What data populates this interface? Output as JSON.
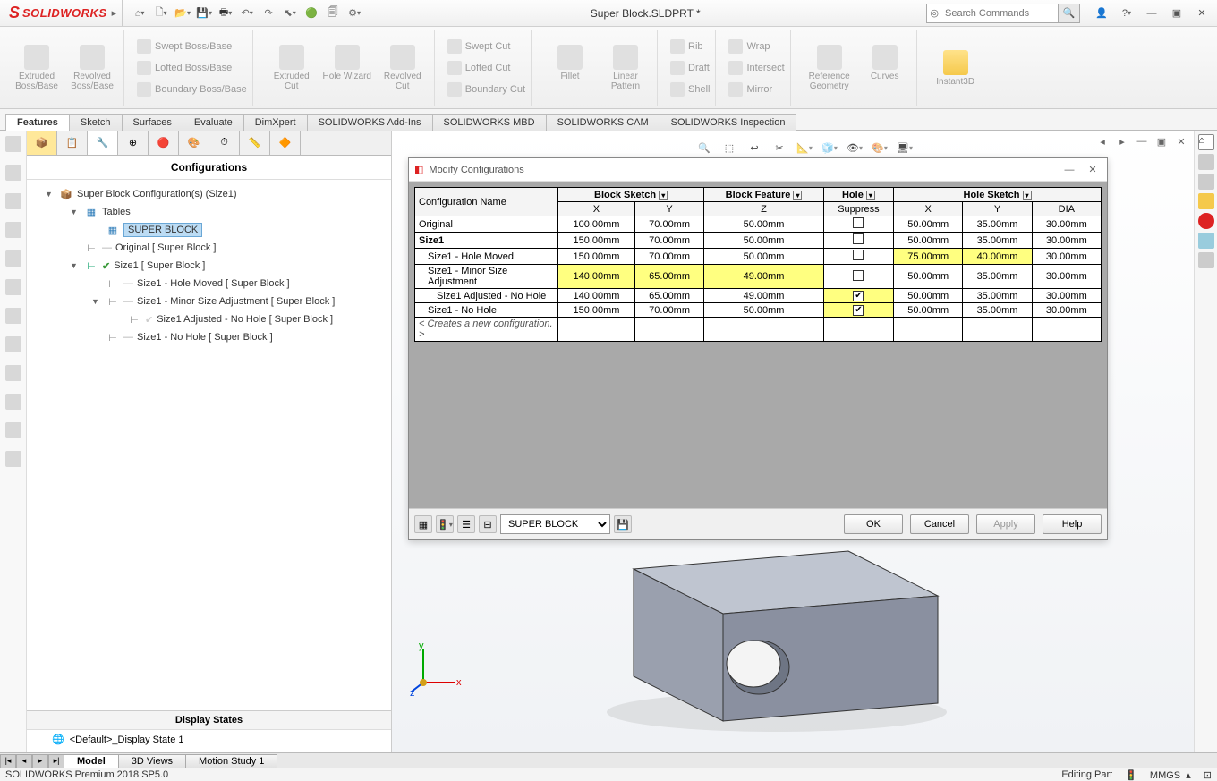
{
  "app": {
    "name": "SOLIDWORKS",
    "title": "Super Block.SLDPRT *",
    "search_placeholder": "Search Commands"
  },
  "ribbon": {
    "extruded_boss": "Extruded Boss/Base",
    "revolved_boss": "Revolved Boss/Base",
    "swept_boss": "Swept Boss/Base",
    "lofted_boss": "Lofted Boss/Base",
    "boundary_boss": "Boundary Boss/Base",
    "extruded_cut": "Extruded Cut",
    "hole_wizard": "Hole Wizard",
    "revolved_cut": "Revolved Cut",
    "swept_cut": "Swept Cut",
    "lofted_cut": "Lofted Cut",
    "boundary_cut": "Boundary Cut",
    "fillet": "Fillet",
    "linear_pattern": "Linear Pattern",
    "rib": "Rib",
    "draft": "Draft",
    "shell": "Shell",
    "wrap": "Wrap",
    "intersect": "Intersect",
    "mirror": "Mirror",
    "ref_geom": "Reference Geometry",
    "curves": "Curves",
    "instant3d": "Instant3D"
  },
  "tabs": [
    "Features",
    "Sketch",
    "Surfaces",
    "Evaluate",
    "DimXpert",
    "SOLIDWORKS Add-Ins",
    "SOLIDWORKS MBD",
    "SOLIDWORKS CAM",
    "SOLIDWORKS Inspection"
  ],
  "side": {
    "header": "Configurations",
    "root": "Super Block Configuration(s)  (Size1)",
    "tables": "Tables",
    "table_name": "SUPER BLOCK",
    "n1": "Original [ Super Block ]",
    "n2": "Size1 [ Super Block ]",
    "n3": "Size1 - Hole Moved [ Super Block ]",
    "n4": "Size1 - Minor Size Adjustment [ Super Block ]",
    "n5": "Size1 Adjusted - No Hole [ Super Block ]",
    "n6": "Size1 - No Hole [ Super Block ]",
    "display_states": "Display States",
    "ds1": "<Default>_Display State 1"
  },
  "dialog": {
    "title": "Modify Configurations",
    "hdr": {
      "config_name": "Configuration Name",
      "block_sketch": "Block Sketch",
      "block_feature": "Block Feature",
      "hole": "Hole",
      "hole_sketch": "Hole Sketch",
      "x": "X",
      "y": "Y",
      "z": "Z",
      "suppress": "Suppress",
      "dia": "DIA"
    },
    "rows": [
      {
        "name": "Original",
        "indent": 0,
        "bold": false,
        "bsX": "100.00mm",
        "bsY": "70.00mm",
        "bfZ": "50.00mm",
        "sup": false,
        "hX": "50.00mm",
        "hY": "35.00mm",
        "dia": "30.00mm",
        "hl": {}
      },
      {
        "name": "Size1",
        "indent": 0,
        "bold": true,
        "bsX": "150.00mm",
        "bsY": "70.00mm",
        "bfZ": "50.00mm",
        "sup": false,
        "hX": "50.00mm",
        "hY": "35.00mm",
        "dia": "30.00mm",
        "hl": {}
      },
      {
        "name": "Size1 - Hole Moved",
        "indent": 1,
        "bold": false,
        "bsX": "150.00mm",
        "bsY": "70.00mm",
        "bfZ": "50.00mm",
        "sup": false,
        "hX": "75.00mm",
        "hY": "40.00mm",
        "dia": "30.00mm",
        "hl": {
          "hX": true,
          "hY": true
        }
      },
      {
        "name": "Size1 - Minor Size Adjustment",
        "indent": 1,
        "bold": false,
        "bsX": "140.00mm",
        "bsY": "65.00mm",
        "bfZ": "49.00mm",
        "sup": false,
        "hX": "50.00mm",
        "hY": "35.00mm",
        "dia": "30.00mm",
        "hl": {
          "bsX": true,
          "bsY": true,
          "bfZ": true
        }
      },
      {
        "name": "Size1 Adjusted - No Hole",
        "indent": 2,
        "bold": false,
        "bsX": "140.00mm",
        "bsY": "65.00mm",
        "bfZ": "49.00mm",
        "sup": true,
        "hX": "50.00mm",
        "hY": "35.00mm",
        "dia": "30.00mm",
        "hl": {
          "sup": true
        }
      },
      {
        "name": "Size1 - No Hole",
        "indent": 1,
        "bold": false,
        "bsX": "150.00mm",
        "bsY": "70.00mm",
        "bfZ": "50.00mm",
        "sup": true,
        "hX": "50.00mm",
        "hY": "35.00mm",
        "dia": "30.00mm",
        "hl": {
          "sup": true
        }
      }
    ],
    "newrow": "< Creates a new configuration. >",
    "select_value": "SUPER BLOCK",
    "btn_ok": "OK",
    "btn_cancel": "Cancel",
    "btn_apply": "Apply",
    "btn_help": "Help"
  },
  "bottom_tabs": [
    "Model",
    "3D Views",
    "Motion Study 1"
  ],
  "status": {
    "left": "SOLIDWORKS Premium 2018 SP5.0",
    "mode": "Editing Part",
    "units": "MMGS"
  }
}
